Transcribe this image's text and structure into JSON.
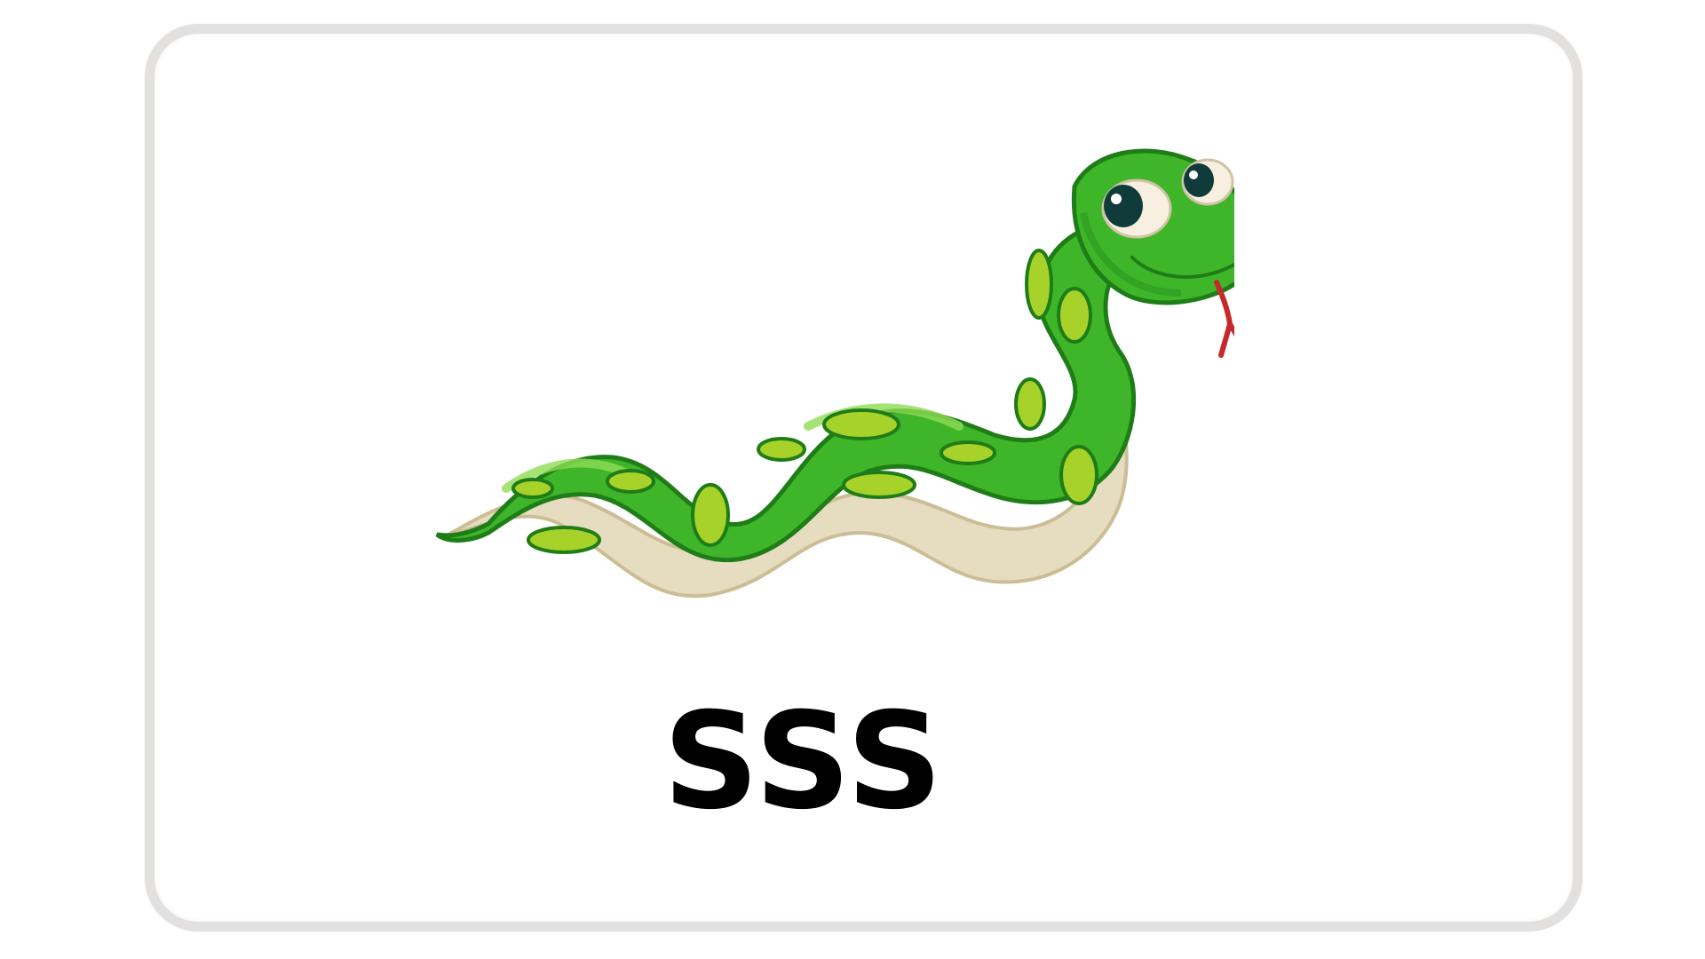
{
  "card": {
    "caption": "SSS",
    "illustration": "snake",
    "colors": {
      "border": "#e3e1e0",
      "background": "#ffffff",
      "snake_body": "#3fb52a",
      "snake_dark": "#1f7d18",
      "snake_spots": "#a7d22a",
      "belly": "#e6dcc0",
      "tongue": "#c42a2a",
      "caption_text": "#000000"
    }
  }
}
